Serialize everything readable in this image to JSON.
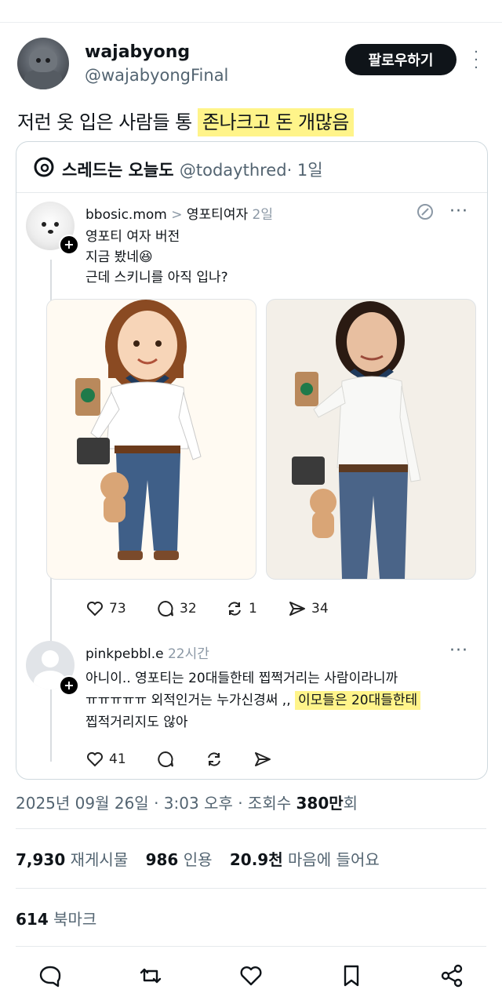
{
  "author": {
    "name": "wajabyong",
    "handle": "@wajabyongFinal",
    "follow_label": "팔로우하기"
  },
  "tweet": {
    "text_plain": "저런 옷 입은 사람들 통 ",
    "text_highlight": "존나크고 돈 개많음"
  },
  "quote": {
    "source_name": "스레드는 오늘도",
    "source_handle": "@todaythred",
    "source_time": "· 1일",
    "post1": {
      "user": "bbosic.mom",
      "separator": ">",
      "topic": "영포티여자",
      "time": "2일",
      "lines": [
        "영포티 여자 버전",
        "지금 봤네😆",
        "근데 스키니를 아직 입나?"
      ],
      "likes": "73",
      "replies": "32",
      "reposts": "1",
      "shares": "34"
    },
    "post2": {
      "user": "pinkpebbl.e",
      "time": "22시간",
      "line1": "아니이.. 영포티는 20대들한테 찝쩍거리는 사람이라니까",
      "line2_plain": "ㅠㅠㅠㅠㅠ 외적인거는 누가신경써 ,, ",
      "line2_highlight": "이모들은 20대들한테",
      "line3": "찝적거리지도 않아",
      "likes": "41"
    }
  },
  "meta": {
    "date_time": "2025년 09월 26일 · 3:03 오후 · 조회수 ",
    "views": "380만",
    "views_suffix": "회"
  },
  "stats": {
    "retweets_count": "7,930",
    "retweets_label": "재게시물",
    "quotes_count": "986",
    "quotes_label": "인용",
    "likes_count": "20.9천",
    "likes_label": "마음에 들어요",
    "bookmarks_count": "614",
    "bookmarks_label": "북마크"
  },
  "colors": {
    "highlight": "#fff48a",
    "text": "#0f1419",
    "muted": "#536471",
    "border": "#cfd9de"
  }
}
